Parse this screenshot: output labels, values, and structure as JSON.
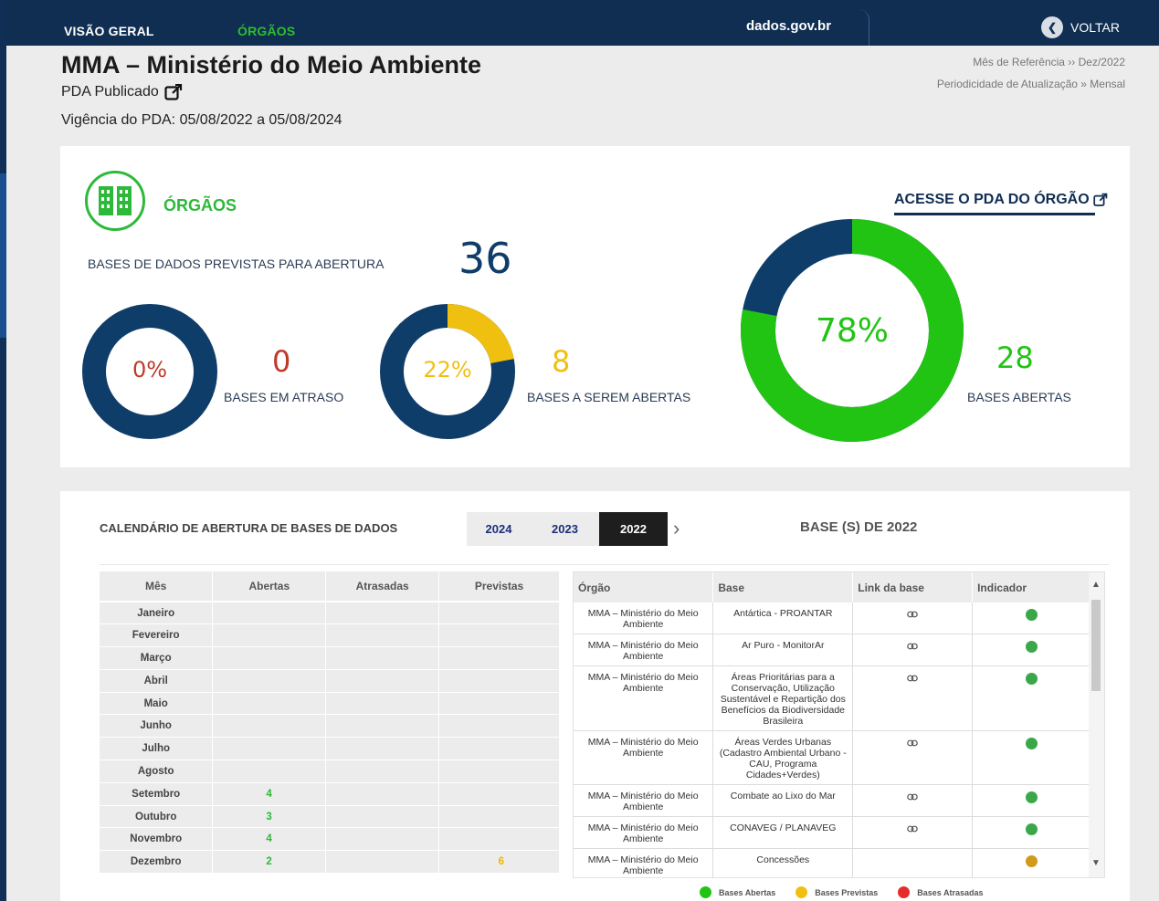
{
  "nav": {
    "items": [
      "VISÃO GERAL",
      "ÓRGÃOS"
    ],
    "site_name": "dados.gov.br",
    "back_label": "VOLTAR"
  },
  "header": {
    "org_title": "MMA – Ministério do Meio Ambiente",
    "pda_published": "PDA Publicado",
    "vigencia": "Vigência do PDA: 05/08/2022 a 05/08/2024",
    "ref_month": "Mês de Referência ›› Dez/2022",
    "periodicity": "Periodicidade de Atualização » Mensal"
  },
  "summary": {
    "section_label": "ÓRGÃOS",
    "pda_link": "ACESSE O PDA DO ÓRGÃO",
    "bases_previstas_label": "BASES DE DADOS PREVISTAS PARA ABERTURA",
    "bases_previstas_count": "36",
    "atraso": {
      "pct": "0%",
      "count": "0",
      "label": "BASES EM ATRASO",
      "fraction": 0
    },
    "a_abrir": {
      "pct": "22%",
      "count": "8",
      "label": "BASES A SEREM ABERTAS",
      "fraction": 0.22
    },
    "abertas": {
      "pct": "78%",
      "count": "28",
      "label": "BASES ABERTAS",
      "fraction": 0.78
    }
  },
  "colors": {
    "navy": "#0f3d69",
    "green": "#2db93a",
    "bright_green": "#22c414",
    "yellow": "#f0c010",
    "red_text": "#c0392b",
    "indicator_green": "#3aa84a",
    "indicator_orange": "#d19a1b"
  },
  "calendar": {
    "title": "CALENDÁRIO DE ABERTURA DE BASES DE DADOS",
    "years": [
      "2024",
      "2023",
      "2022"
    ],
    "active_year": "2022",
    "base_heading": "BASE (S) DE 2022",
    "month_columns": [
      "Mês",
      "Abertas",
      "Atrasadas",
      "Previstas"
    ],
    "months": [
      {
        "mes": "Janeiro",
        "abertas": "",
        "atrasadas": "",
        "previstas": ""
      },
      {
        "mes": "Fevereiro",
        "abertas": "",
        "atrasadas": "",
        "previstas": ""
      },
      {
        "mes": "Março",
        "abertas": "",
        "atrasadas": "",
        "previstas": ""
      },
      {
        "mes": "Abril",
        "abertas": "",
        "atrasadas": "",
        "previstas": ""
      },
      {
        "mes": "Maio",
        "abertas": "",
        "atrasadas": "",
        "previstas": ""
      },
      {
        "mes": "Junho",
        "abertas": "",
        "atrasadas": "",
        "previstas": ""
      },
      {
        "mes": "Julho",
        "abertas": "",
        "atrasadas": "",
        "previstas": ""
      },
      {
        "mes": "Agosto",
        "abertas": "",
        "atrasadas": "",
        "previstas": ""
      },
      {
        "mes": "Setembro",
        "abertas": "4",
        "atrasadas": "",
        "previstas": ""
      },
      {
        "mes": "Outubro",
        "abertas": "3",
        "atrasadas": "",
        "previstas": ""
      },
      {
        "mes": "Novembro",
        "abertas": "4",
        "atrasadas": "",
        "previstas": ""
      },
      {
        "mes": "Dezembro",
        "abertas": "2",
        "atrasadas": "",
        "previstas": "6"
      }
    ],
    "base_columns": [
      "Órgão",
      "Base",
      "Link da base",
      "Indicador"
    ],
    "bases": [
      {
        "orgao": "MMA – Ministério do Meio Ambiente",
        "base": "Antártica - PROANTAR",
        "has_link": true,
        "status": "aberta"
      },
      {
        "orgao": "MMA – Ministério do Meio Ambiente",
        "base": "Ar Puro - MonitorAr",
        "has_link": true,
        "status": "aberta"
      },
      {
        "orgao": "MMA – Ministério do Meio Ambiente",
        "base": "Áreas Prioritárias para a Conservação, Utilização Sustentável e Repartição dos Benefícios da Biodiversidade Brasileira",
        "has_link": true,
        "status": "aberta"
      },
      {
        "orgao": "MMA – Ministério do Meio Ambiente",
        "base": "Áreas Verdes Urbanas (Cadastro Ambiental Urbano - CAU, Programa Cidades+Verdes)",
        "has_link": true,
        "status": "aberta"
      },
      {
        "orgao": "MMA – Ministério do Meio Ambiente",
        "base": "Combate ao Lixo do Mar",
        "has_link": true,
        "status": "aberta"
      },
      {
        "orgao": "MMA – Ministério do Meio Ambiente",
        "base": "CONAVEG / PLANAVEG",
        "has_link": true,
        "status": "aberta"
      },
      {
        "orgao": "MMA – Ministério do Meio Ambiente",
        "base": "Concessões",
        "has_link": false,
        "status": "prevista"
      }
    ],
    "legend": [
      "Bases Abertas",
      "Bases Previstas",
      "Bases Atrasadas"
    ]
  }
}
